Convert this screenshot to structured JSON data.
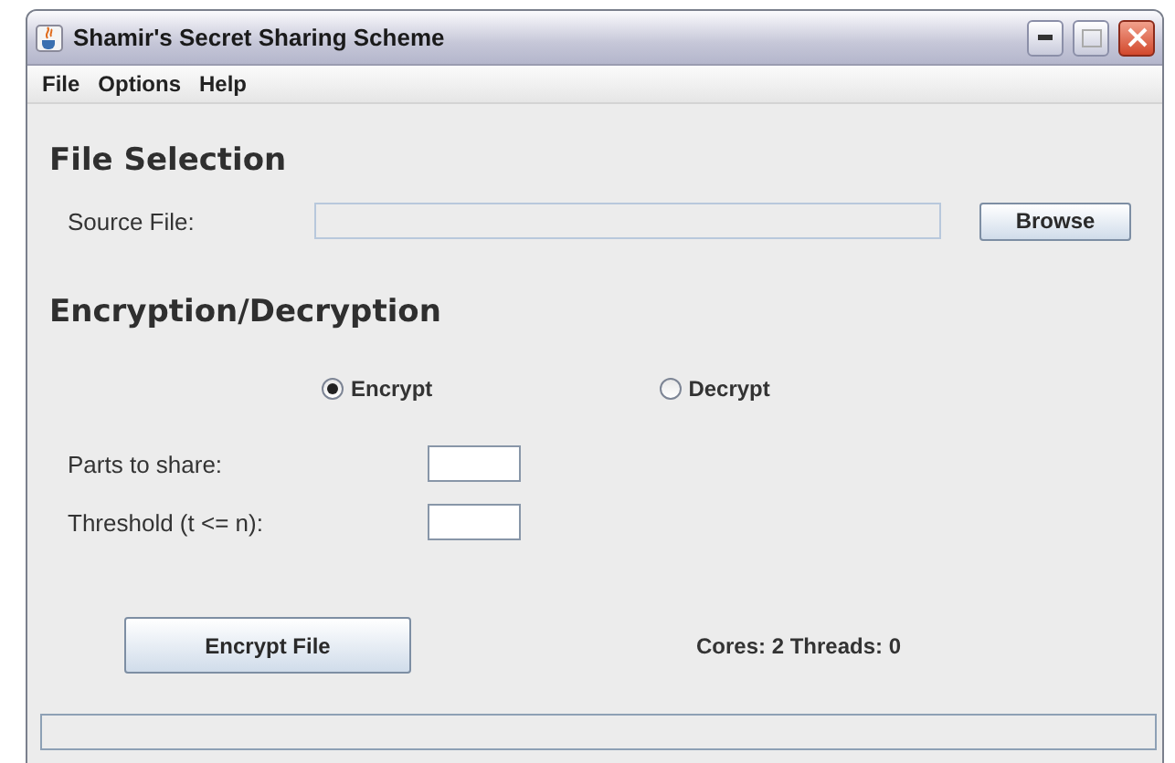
{
  "window": {
    "title": "Shamir's Secret Sharing Scheme"
  },
  "menu": [
    "File",
    "Options",
    "Help"
  ],
  "file_selection": {
    "heading": "File Selection",
    "label": "Source File:",
    "button": "Browse"
  },
  "mode": {
    "heading": "Encryption/Decryption",
    "options": [
      {
        "label": "Encrypt",
        "selected": true
      },
      {
        "label": "Decrypt",
        "selected": false
      }
    ]
  },
  "fields": [
    {
      "label": "Parts to share:"
    },
    {
      "label": "Threshold (t <= n):"
    }
  ],
  "action_button": "Encrypt File",
  "status": "Cores: 2 Threads: 0"
}
